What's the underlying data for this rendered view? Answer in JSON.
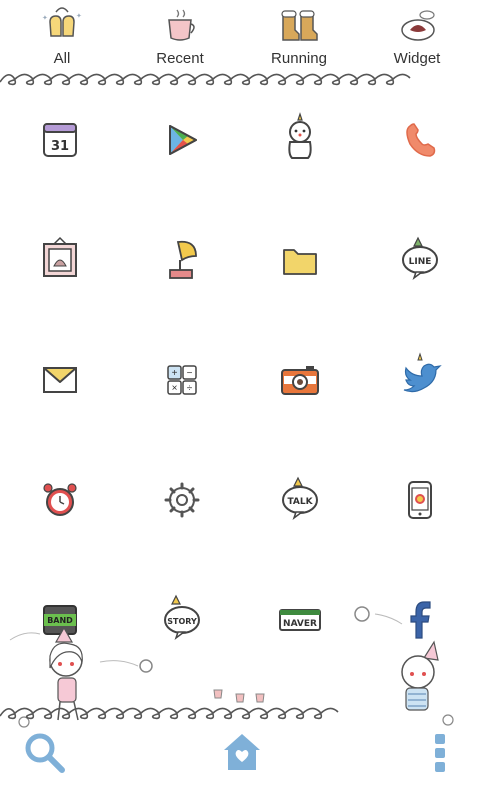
{
  "tabs": [
    {
      "label": "All",
      "icon": "mittens-icon"
    },
    {
      "label": "Recent",
      "icon": "coffee-cup-icon"
    },
    {
      "label": "Running",
      "icon": "boots-icon"
    },
    {
      "label": "Widget",
      "icon": "mochi-icon"
    }
  ],
  "apps": {
    "calendar": {
      "text": "31"
    },
    "line": {
      "text": "LINE"
    },
    "talk": {
      "text": "TALK"
    },
    "band": {
      "text": "BAND"
    },
    "story": {
      "text": "STORY"
    },
    "naver": {
      "text": "NAVER"
    }
  },
  "bottom_bar": {
    "search_icon": "search-icon",
    "home_icon": "home-heart-icon",
    "menu_icon": "menu-dots-icon"
  },
  "colors": {
    "ink": "#444444",
    "label": "#333333",
    "blue": "#7fb0d8",
    "orange": "#e8763b",
    "green": "#3e8a3e"
  }
}
